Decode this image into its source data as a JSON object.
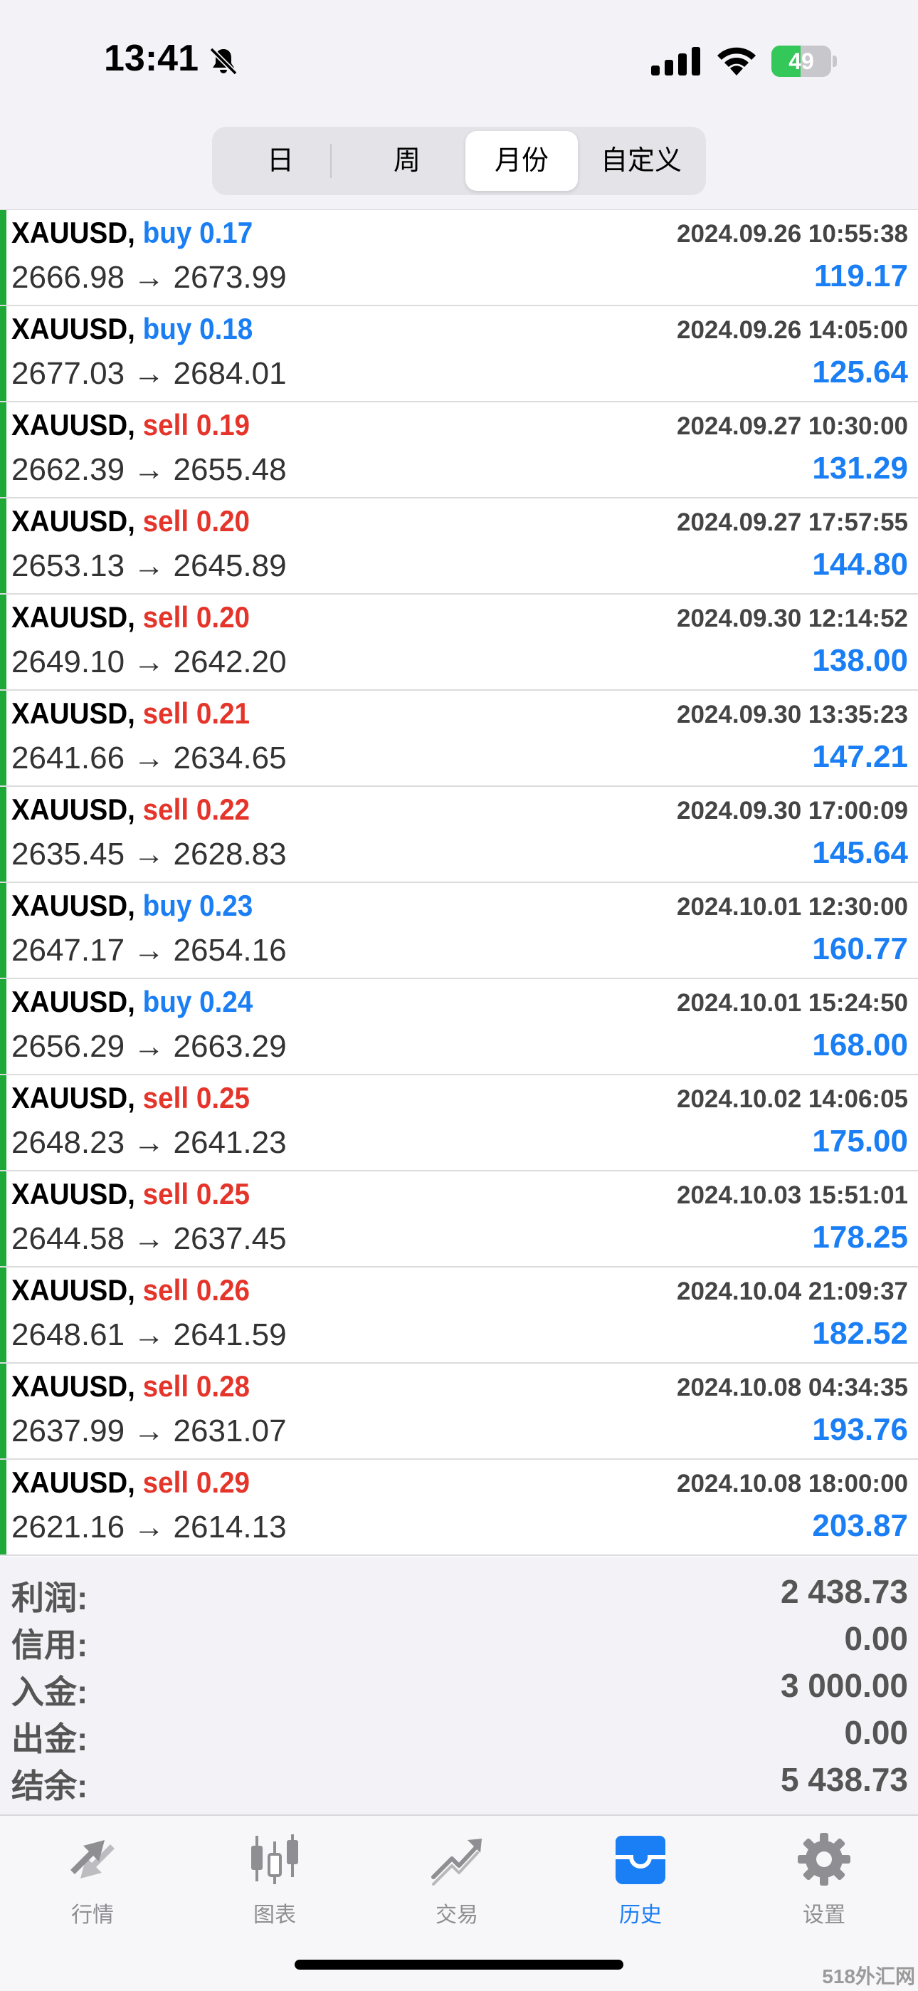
{
  "status_bar": {
    "time": "13:41",
    "battery": "49",
    "battery_level": 0.49,
    "icons": [
      "bell-slash-icon",
      "cellular-signal-icon",
      "wifi-icon",
      "battery-charging-icon"
    ]
  },
  "period_tabs": [
    {
      "label": "日",
      "active": false
    },
    {
      "label": "周",
      "active": false
    },
    {
      "label": "月份",
      "active": true
    },
    {
      "label": "自定义",
      "active": false
    }
  ],
  "trades": [
    {
      "symbol": "XAUUSD,",
      "side": "buy",
      "volume": "0.17",
      "open": "2666.98",
      "close": "2673.99",
      "arrow": "→",
      "time": "2024.09.26 10:55:38",
      "profit": "119.17"
    },
    {
      "symbol": "XAUUSD,",
      "side": "buy",
      "volume": "0.18",
      "open": "2677.03",
      "close": "2684.01",
      "arrow": "→",
      "time": "2024.09.26 14:05:00",
      "profit": "125.64"
    },
    {
      "symbol": "XAUUSD,",
      "side": "sell",
      "volume": "0.19",
      "open": "2662.39",
      "close": "2655.48",
      "arrow": "→",
      "time": "2024.09.27 10:30:00",
      "profit": "131.29"
    },
    {
      "symbol": "XAUUSD,",
      "side": "sell",
      "volume": "0.20",
      "open": "2653.13",
      "close": "2645.89",
      "arrow": "→",
      "time": "2024.09.27 17:57:55",
      "profit": "144.80"
    },
    {
      "symbol": "XAUUSD,",
      "side": "sell",
      "volume": "0.20",
      "open": "2649.10",
      "close": "2642.20",
      "arrow": "→",
      "time": "2024.09.30 12:14:52",
      "profit": "138.00"
    },
    {
      "symbol": "XAUUSD,",
      "side": "sell",
      "volume": "0.21",
      "open": "2641.66",
      "close": "2634.65",
      "arrow": "→",
      "time": "2024.09.30 13:35:23",
      "profit": "147.21"
    },
    {
      "symbol": "XAUUSD,",
      "side": "sell",
      "volume": "0.22",
      "open": "2635.45",
      "close": "2628.83",
      "arrow": "→",
      "time": "2024.09.30 17:00:09",
      "profit": "145.64"
    },
    {
      "symbol": "XAUUSD,",
      "side": "buy",
      "volume": "0.23",
      "open": "2647.17",
      "close": "2654.16",
      "arrow": "→",
      "time": "2024.10.01 12:30:00",
      "profit": "160.77"
    },
    {
      "symbol": "XAUUSD,",
      "side": "buy",
      "volume": "0.24",
      "open": "2656.29",
      "close": "2663.29",
      "arrow": "→",
      "time": "2024.10.01 15:24:50",
      "profit": "168.00"
    },
    {
      "symbol": "XAUUSD,",
      "side": "sell",
      "volume": "0.25",
      "open": "2648.23",
      "close": "2641.23",
      "arrow": "→",
      "time": "2024.10.02 14:06:05",
      "profit": "175.00"
    },
    {
      "symbol": "XAUUSD,",
      "side": "sell",
      "volume": "0.25",
      "open": "2644.58",
      "close": "2637.45",
      "arrow": "→",
      "time": "2024.10.03 15:51:01",
      "profit": "178.25"
    },
    {
      "symbol": "XAUUSD,",
      "side": "sell",
      "volume": "0.26",
      "open": "2648.61",
      "close": "2641.59",
      "arrow": "→",
      "time": "2024.10.04 21:09:37",
      "profit": "182.52"
    },
    {
      "symbol": "XAUUSD,",
      "side": "sell",
      "volume": "0.28",
      "open": "2637.99",
      "close": "2631.07",
      "arrow": "→",
      "time": "2024.10.08 04:34:35",
      "profit": "193.76"
    },
    {
      "symbol": "XAUUSD,",
      "side": "sell",
      "volume": "0.29",
      "open": "2621.16",
      "close": "2614.13",
      "arrow": "→",
      "time": "2024.10.08 18:00:00",
      "profit": "203.87"
    }
  ],
  "summary": [
    {
      "label": "利润:",
      "value": "2 438.73"
    },
    {
      "label": "信用:",
      "value": "0.00"
    },
    {
      "label": "入金:",
      "value": "3 000.00"
    },
    {
      "label": "出金:",
      "value": "0.00"
    },
    {
      "label": "结余:",
      "value": "5 438.73"
    }
  ],
  "tab_bar": [
    {
      "label": "行情",
      "icon": "quotes-icon",
      "active": false
    },
    {
      "label": "图表",
      "icon": "chart-icon",
      "active": false
    },
    {
      "label": "交易",
      "icon": "trade-icon",
      "active": false
    },
    {
      "label": "历史",
      "icon": "history-icon",
      "active": true
    },
    {
      "label": "设置",
      "icon": "settings-icon",
      "active": false
    }
  ],
  "watermark": "518外汇网",
  "colors": {
    "buy": "#1a7ef5",
    "sell": "#e5352b",
    "profit": "#1a7ef5",
    "row_accent": "#1ea838",
    "tab_active": "#1a7ef5",
    "tab_inactive": "#8e8e93"
  }
}
